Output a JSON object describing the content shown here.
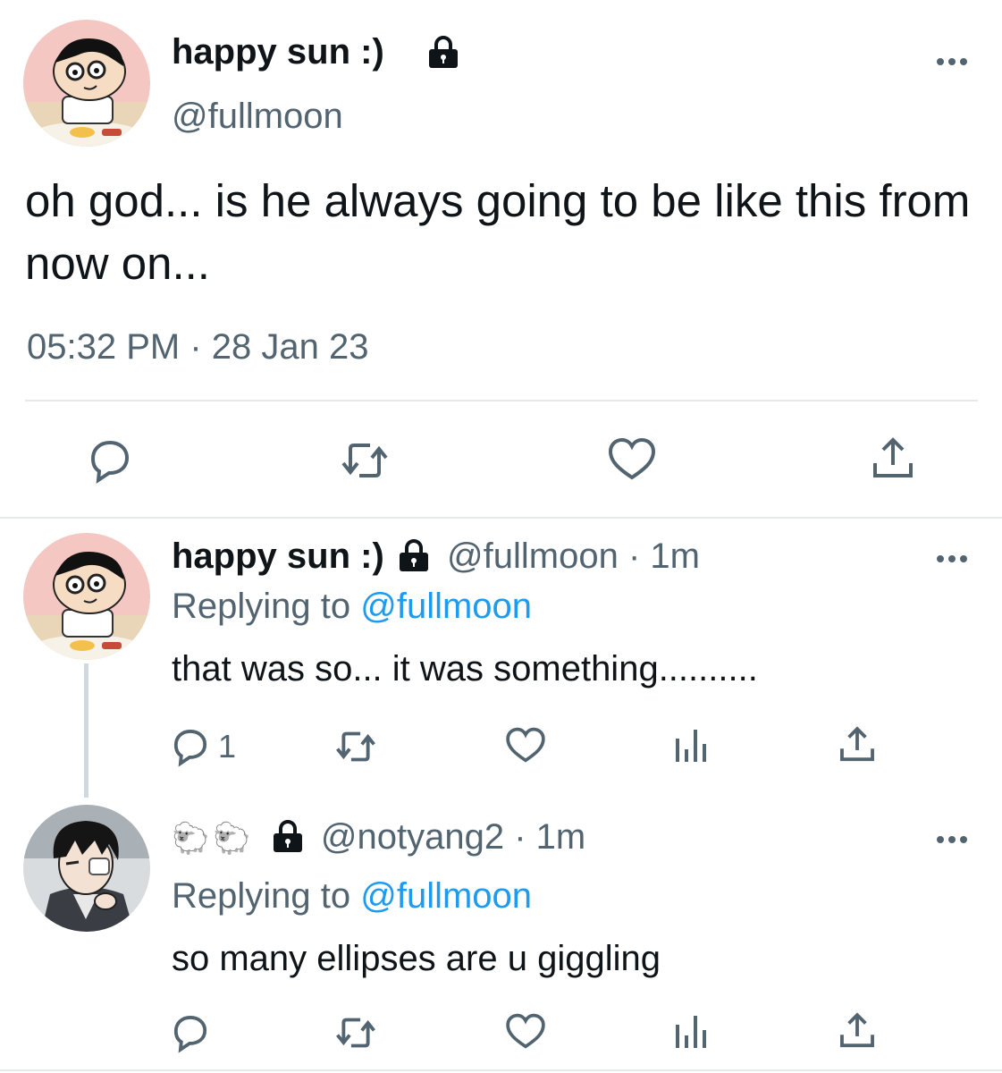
{
  "main_tweet": {
    "display_name": "happy sun :)",
    "handle": "@fullmoon",
    "text": "oh god... is he always going to be like this from now on...",
    "timestamp": "05:32 PM · 28 Jan 23",
    "avatar_icon": "cartoon-boy-avatar",
    "protected_icon": "lock-icon",
    "actions": [
      "reply-icon",
      "retweet-icon",
      "like-icon",
      "share-icon"
    ]
  },
  "replies": [
    {
      "display_name": "happy sun :)",
      "handle": "@fullmoon",
      "time": "· 1m",
      "replying_label": "Replying to",
      "replying_handle": "@fullmoon",
      "text": "that was so... it was something..........",
      "reply_count": "1",
      "avatar_icon": "cartoon-boy-avatar"
    },
    {
      "display_name": "🐑🐑",
      "handle": "@notyang2",
      "time": "· 1m",
      "replying_label": "Replying to",
      "replying_handle": "@fullmoon",
      "text": "so many ellipses are u giggling",
      "reply_count": "",
      "avatar_icon": "anime-character-avatar"
    }
  ],
  "colors": {
    "link": "#1d9bf0",
    "secondary": "#536471",
    "thread_line": "#cfd9de"
  }
}
